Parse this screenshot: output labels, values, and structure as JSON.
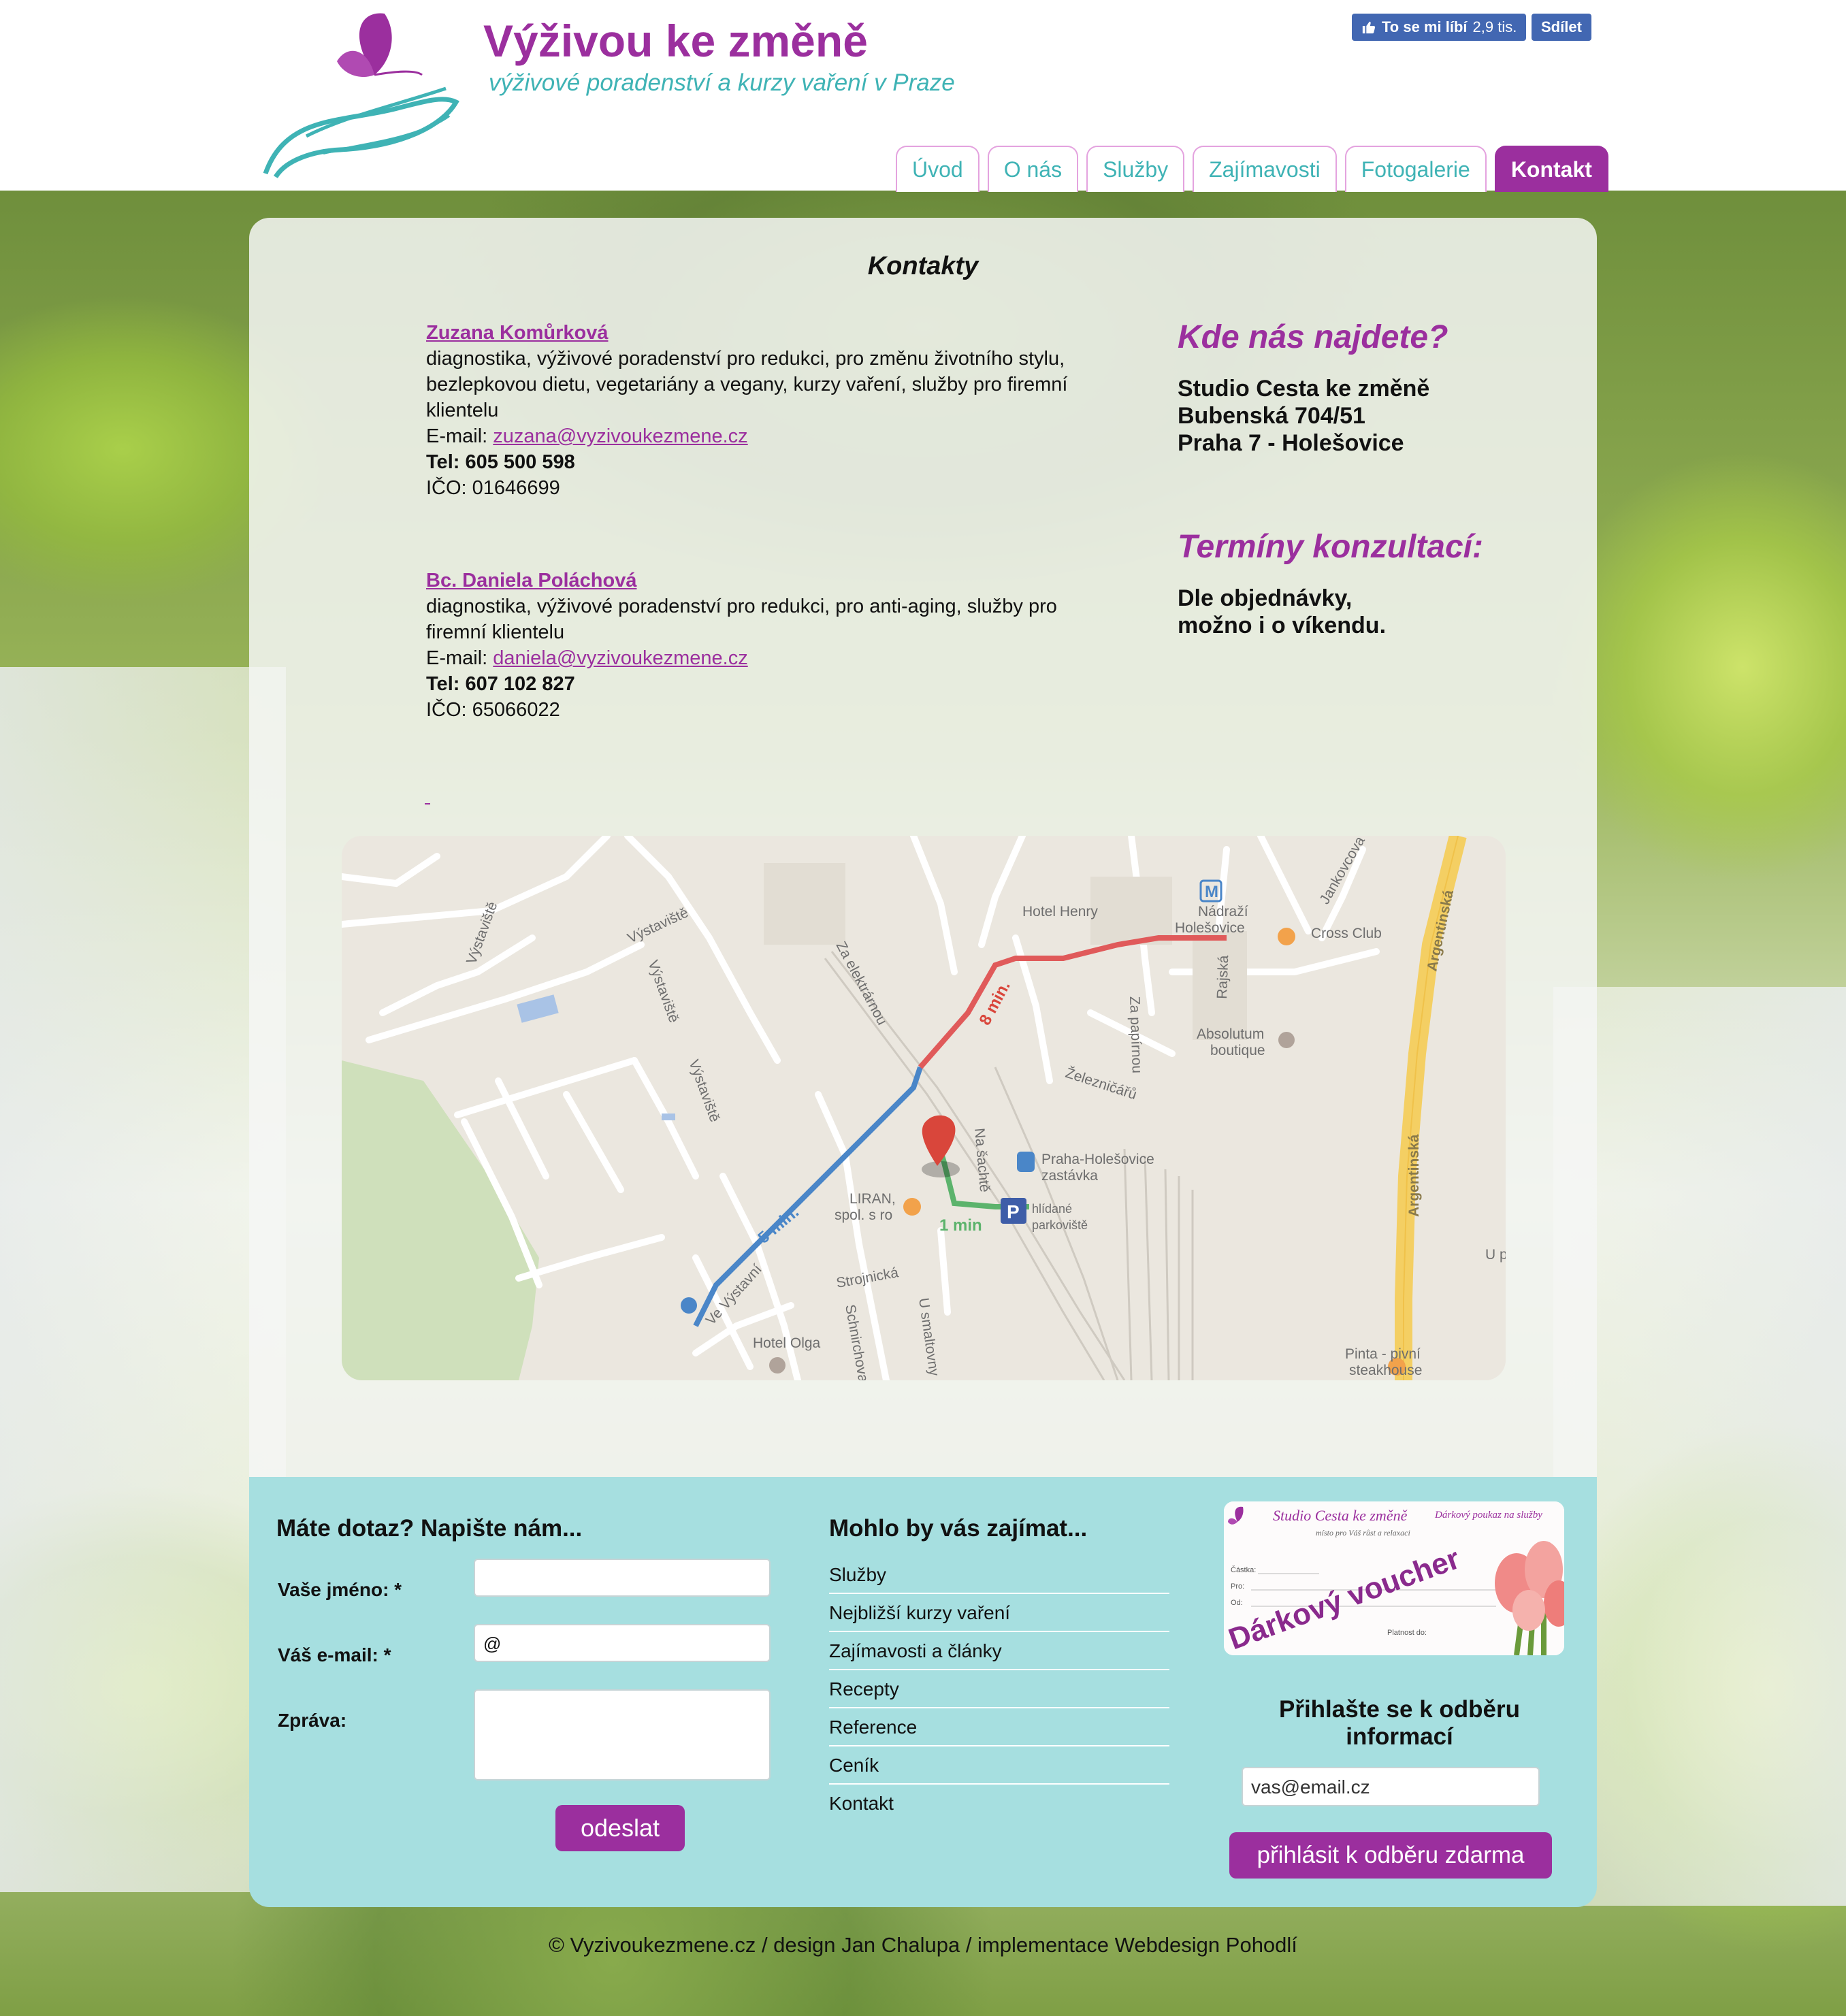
{
  "header": {
    "title": "Výživou ke změně",
    "subtitle": "výživové poradenství a kurzy vaření v Praze",
    "fb_like_label": "To se mi líbí",
    "fb_like_count": "2,9 tis.",
    "fb_share_label": "Sdílet"
  },
  "nav": {
    "items": [
      {
        "label": "Úvod"
      },
      {
        "label": "O nás"
      },
      {
        "label": "Služby"
      },
      {
        "label": "Zajímavosti"
      },
      {
        "label": "Fotogalerie"
      },
      {
        "label": "Kontakt"
      }
    ],
    "active": "Kontakt"
  },
  "main": {
    "page_title": "Kontakty",
    "contacts": [
      {
        "name": "Zuzana Komůrková",
        "description": "diagnostika, výživové poradenství pro redukci, pro změnu životního stylu, bezlepkovou dietu, vegetariány a vegany, kurzy vaření, služby pro firemní klientelu",
        "email_label": "E-mail:",
        "email": "zuzana@vyzivoukezmene.cz",
        "tel": "Tel: 605 500 598",
        "ico": "IČO: 01646699"
      },
      {
        "name": "Bc. Daniela Poláchová",
        "description": "diagnostika, výživové poradenství pro redukci, pro anti-aging, služby pro firemní klientelu",
        "email_label": "E-mail:",
        "email": "daniela@vyzivoukezmene.cz",
        "tel": "Tel: 607 102 827",
        "ico": "IČO: 65066022"
      }
    ],
    "where": {
      "heading": "Kde nás najdete?",
      "line1": "Studio Cesta ke změně",
      "line2": "Bubenská 704/51",
      "line3": "Praha 7 - Holešovice"
    },
    "terms": {
      "heading": "Termíny konzultací:",
      "line1": "Dle objednávky,",
      "line2": "možno i o víkendu."
    },
    "map": {
      "labels": {
        "vystaviste1": "Výstaviště",
        "vystaviste2": "Výstaviště",
        "vystaviste3": "Výstaviště",
        "vystaviste4": "Výstaviště",
        "za_elektrarnou": "Za elektrárnou",
        "hotel_henry": "Hotel Henry",
        "nadrazi": "Nádraží",
        "holesovice": "Holešovice",
        "cross_club": "Cross Club",
        "jankovcova": "Jankovcova",
        "argentinska1": "Argentinská",
        "argentinska2": "Argentinská",
        "rajska": "Rajská",
        "za_papirnou": "Za papírnou",
        "absolutum1": "Absolutum",
        "absolutum2": "boutique",
        "zeleznicaru": "Železničářů",
        "stop1": "Praha-Holešovice",
        "stop2": "zastávka",
        "na_sachte": "Na šachtě",
        "parking1": "hlídané",
        "parking2": "parkoviště",
        "liran1": "LIRAN,",
        "liran2": "spol. s ro",
        "vystavni": "Ve Výstavní",
        "strojnicka": "Strojnická",
        "schnirchova": "Schnirchova",
        "u_smaltovny": "U smaltovny",
        "hotel_olga": "Hotel Olga",
        "pinta1": "Pinta - pivní",
        "pinta2": "steakhouse",
        "up": "U p",
        "min8": "8 min.",
        "min5": "5 min.",
        "min1": "1 min",
        "parking_p": "P",
        "metro_m": "M"
      }
    }
  },
  "footer": {
    "form": {
      "title": "Máte dotaz? Napište nám...",
      "name_label": "Vaše jméno: *",
      "email_label": "Váš e-mail: *",
      "email_value": "@",
      "message_label": "Zpráva:",
      "submit": "odeslat"
    },
    "links": {
      "title": "Mohlo by vás zajímat...",
      "items": [
        {
          "label": "Služby"
        },
        {
          "label": "Nejbližší kurzy vaření"
        },
        {
          "label": "Zajímavosti a články"
        },
        {
          "label": "Recepty"
        },
        {
          "label": "Reference"
        },
        {
          "label": "Ceník"
        },
        {
          "label": "Kontakt"
        }
      ]
    },
    "voucher": {
      "studio": "Studio Cesta ke změně",
      "tagline": "místo pro Váš růst a relaxaci",
      "gift_line": "Dárkový poukaz na služby",
      "amount": "Částka:",
      "for": "Pro:",
      "from": "Od:",
      "validity": "Platnost do:",
      "headline": "Dárkový voucher"
    },
    "subscribe": {
      "title": "Přihlašte se k odběru informací",
      "placeholder": "vas@email.cz",
      "button": "přihlásit k odběru zdarma"
    },
    "copyright": "© Vyzivoukezmene.cz / design Jan Chalupa / implementace Webdesign Pohodlí"
  },
  "colors": {
    "brand_purple": "#9b2f9e",
    "brand_teal": "#3fb3b5",
    "footer_bg": "#a6dfe0",
    "facebook": "#4267b2"
  }
}
